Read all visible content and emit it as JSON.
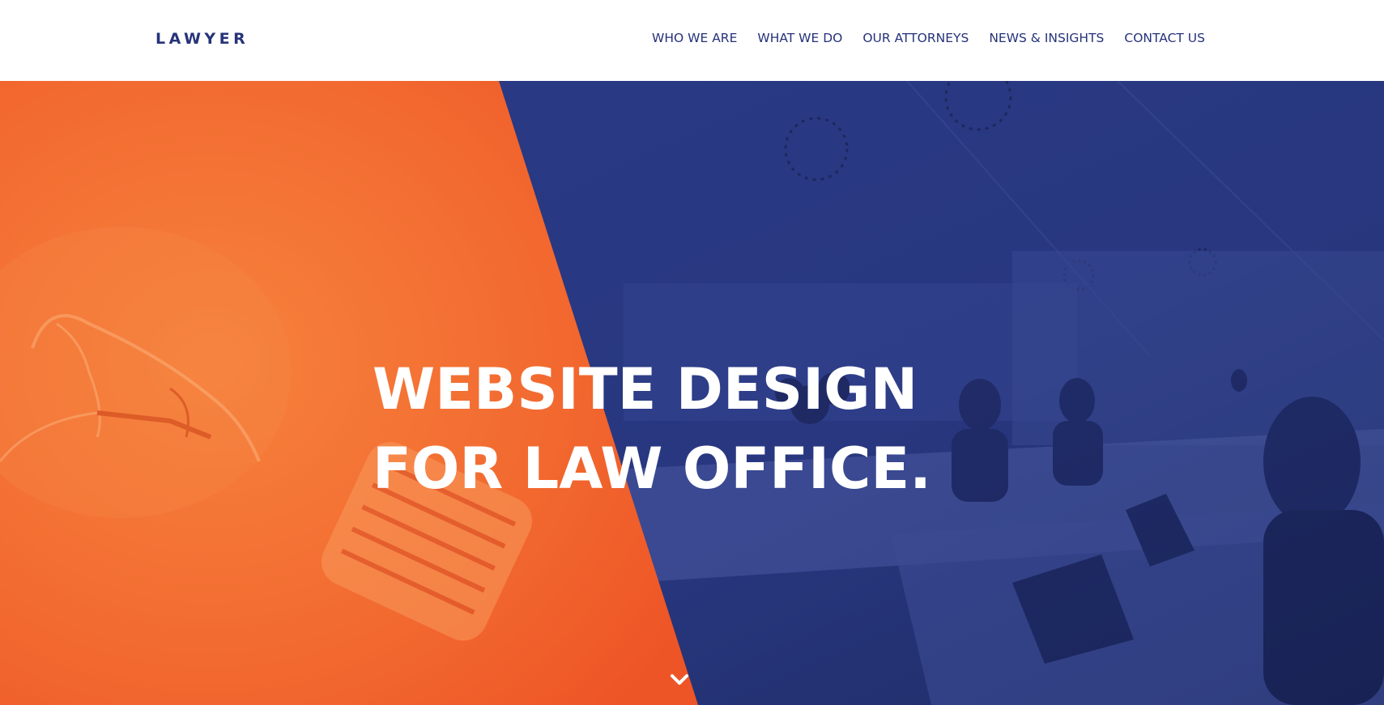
{
  "header": {
    "logo": "LAWYER",
    "nav": [
      {
        "label": "WHO WE ARE"
      },
      {
        "label": "WHAT WE DO"
      },
      {
        "label": "OUR ATTORNEYS"
      },
      {
        "label": "NEWS & INSIGHTS"
      },
      {
        "label": "CONTACT US"
      }
    ]
  },
  "hero": {
    "headline_line1": "WEBSITE DESIGN",
    "headline_line2": "FOR LAW OFFICE.",
    "scroll_icon": "chevron-down-icon"
  },
  "colors": {
    "brand_navy": "#26337a",
    "hero_orange": "#f2612e",
    "hero_blue": "#28377f",
    "text_white": "#ffffff"
  }
}
